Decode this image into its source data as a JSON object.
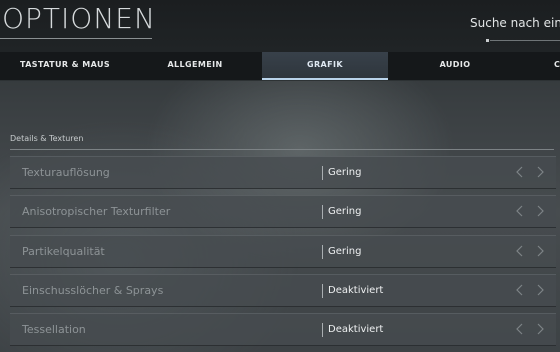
{
  "header": {
    "title": "OPTIONEN",
    "search_label": "Suche nach ein"
  },
  "tabs": [
    {
      "label": "TASTATUR & MAUS",
      "active": false
    },
    {
      "label": "ALLGEMEIN",
      "active": false
    },
    {
      "label": "GRAFIK",
      "active": true
    },
    {
      "label": "AUDIO",
      "active": false
    },
    {
      "label": "C",
      "active": false
    }
  ],
  "section": {
    "label": "Details & Texturen"
  },
  "settings": [
    {
      "label": "Texturauflösung",
      "value": "Gering"
    },
    {
      "label": "Anisotropischer Texturfilter",
      "value": "Gering"
    },
    {
      "label": "Partikelqualität",
      "value": "Gering"
    },
    {
      "label": "Einschusslöcher & Sprays",
      "value": "Deaktiviert"
    },
    {
      "label": "Tessellation",
      "value": "Deaktiviert"
    }
  ],
  "icons": {
    "prev": "chevron-left-icon",
    "next": "chevron-right-icon"
  },
  "colors": {
    "active_tab_accent": "#b9d3ea",
    "value_text": "#eef0f1",
    "label_text": "#8d9396"
  }
}
